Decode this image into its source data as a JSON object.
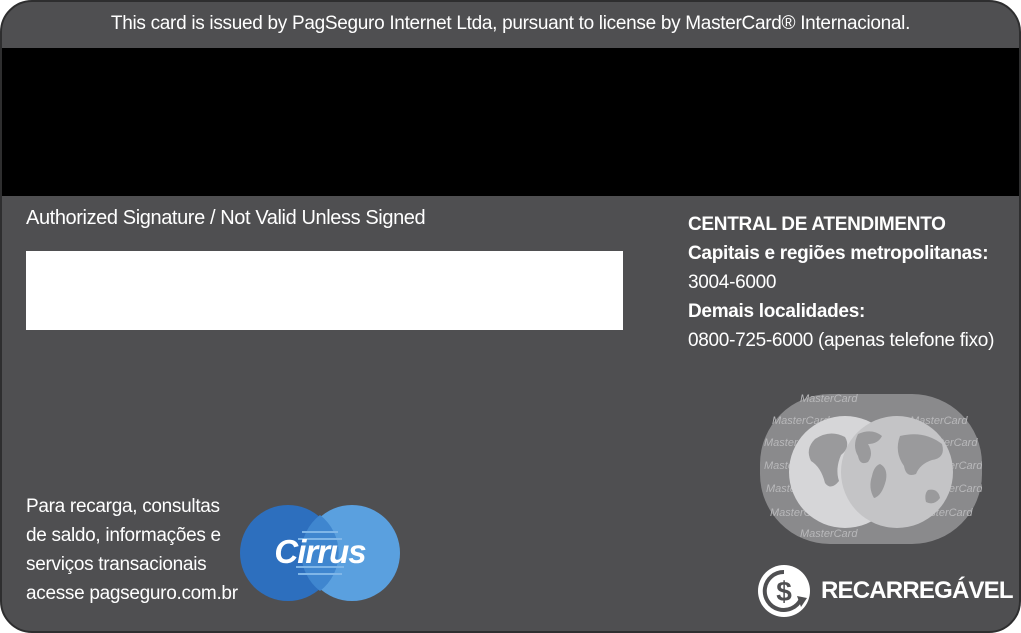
{
  "card": {
    "issuer_text": "This card is issued by PagSeguro Internet Ltda, pursuant to license by MasterCard® Internacional.",
    "signature_label": "Authorized Signature / Not Valid Unless Signed",
    "support": {
      "title": "CENTRAL DE ATENDIMENTO",
      "metro_label": "Capitais e regiões metropolitanas:",
      "metro_phone": "3004-6000",
      "other_label": "Demais localidades:",
      "other_phone": "0800-725-6000 (apenas telefone fixo)"
    },
    "info_lines": [
      "Para recarga, consultas",
      "de saldo, informações e",
      "serviços transacionais",
      "acesse pagseguro.com.br"
    ],
    "cirrus_logo": "Cirrus",
    "hologram_text": "MasterCard",
    "recharge_label": "RECARREGÁVEL",
    "icons": [
      "cirrus-logo",
      "mastercard-hologram-icon",
      "recharge-dollar-icon"
    ],
    "colors": {
      "card_bg": "#4f4f51",
      "stripe": "#000000",
      "cirrus_left": "#2d6fbe",
      "cirrus_right": "#5aa0df"
    }
  }
}
